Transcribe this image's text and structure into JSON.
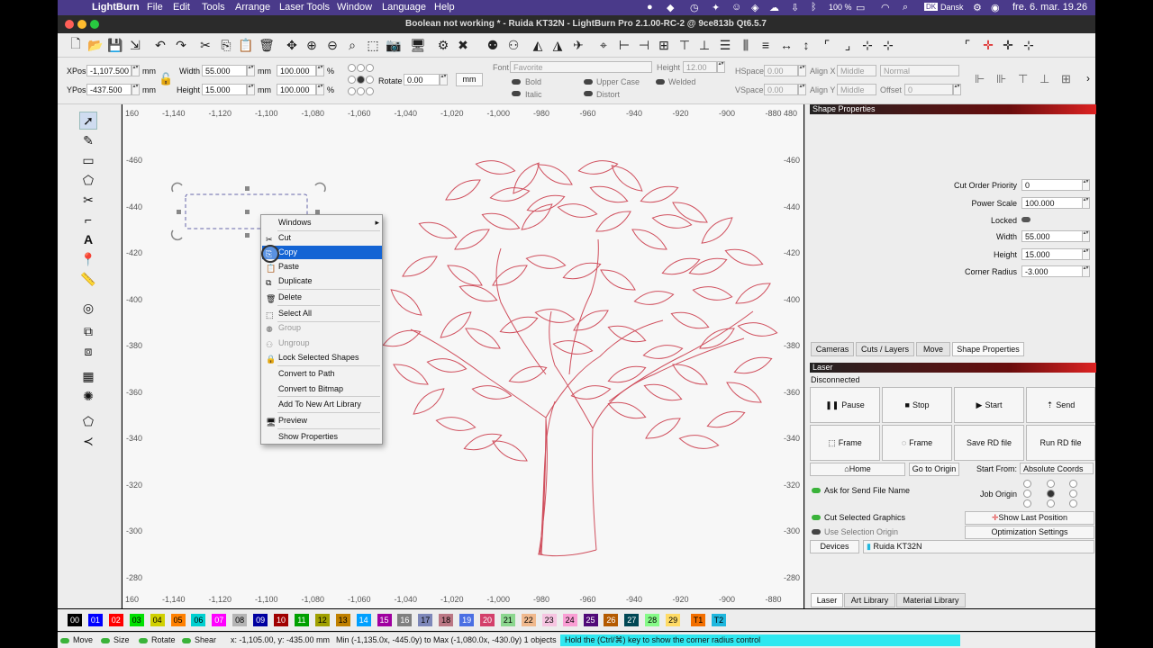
{
  "menubar": {
    "app": "LightBurn",
    "items": [
      "File",
      "Edit",
      "Tools",
      "Arrange",
      "Laser Tools",
      "Window",
      "Language",
      "Help"
    ],
    "battery": "100 %",
    "keyboard": "Dansk",
    "keyboard_badge": "DK",
    "datetime": "fre. 6. mar.  19.26"
  },
  "window_title": "Boolean not working * - Ruida KT32N - LightBurn Pro 2.1.00-RC-2 @ 9ce813b Qt6.5.7",
  "shape_props_bar": {
    "xpos_label": "XPos",
    "xpos": "-1,107.500",
    "ypos_label": "YPos",
    "ypos": "-437.500",
    "unit": "mm",
    "width_label": "Width",
    "width": "55.000",
    "height_label": "Height",
    "height": "15.000",
    "scale_w": "100.000",
    "scale_h": "100.000",
    "pct": "%",
    "rotate_label": "Rotate",
    "rotate": "0.00",
    "unit_button": "mm"
  },
  "text_bar": {
    "font_label": "Font",
    "font": "Favorite",
    "height_label": "Height",
    "height": "12.00",
    "hspace_label": "HSpace",
    "hspace": "0.00",
    "vspace_label": "VSpace",
    "vspace": "0.00",
    "alignx_label": "Align X",
    "alignx": "Middle",
    "aligny_label": "Align Y",
    "aligny": "Middle",
    "style": "Normal",
    "offset_label": "Offset",
    "offset": "0",
    "bold": "Bold",
    "italic": "Italic",
    "upper": "Upper Case",
    "distort": "Distort",
    "welded": "Welded"
  },
  "ruler": {
    "top": [
      "-1,140",
      "-1,120",
      "-1,100",
      "-1,080",
      "-1,060",
      "-1,040",
      "-1,020",
      "-1,000",
      "-980",
      "-960",
      "-940",
      "-920",
      "-900",
      "-880"
    ],
    "bottom": [
      "-1,140",
      "-1,120",
      "-1,100",
      "-1,080",
      "-1,060",
      "-1,040",
      "-1,020",
      "-1,000",
      "-980",
      "-960",
      "-940",
      "-920",
      "-900",
      "-880"
    ],
    "left": [
      "-460",
      "-440",
      "-420",
      "-400",
      "-380",
      "-360",
      "-340",
      "-320",
      "-300",
      "-280"
    ],
    "right": [
      "-460",
      "-440",
      "-420",
      "-400",
      "-380",
      "-360",
      "-340",
      "-320",
      "-300",
      "-280"
    ],
    "corner_top_left": "160",
    "corner_top_right": "480",
    "corner_bottom_left": "160"
  },
  "context_menu": [
    {
      "label": "Windows",
      "icon": "",
      "submenu": true
    },
    {
      "label": "Cut",
      "icon": "scissors-icon"
    },
    {
      "label": "Copy",
      "icon": "copy-icon",
      "selected": true
    },
    {
      "label": "Paste",
      "icon": "paste-icon"
    },
    {
      "label": "Duplicate",
      "icon": "duplicate-icon"
    },
    {
      "label": "Delete",
      "icon": "trash-icon"
    },
    {
      "label": "Select All",
      "icon": "select-all-icon"
    },
    {
      "label": "Group",
      "icon": "group-icon",
      "disabled": true
    },
    {
      "label": "Ungroup",
      "icon": "ungroup-icon",
      "disabled": true
    },
    {
      "label": "Lock Selected Shapes",
      "icon": "lock-icon"
    },
    {
      "label": "Convert to Path",
      "icon": ""
    },
    {
      "label": "Convert to Bitmap",
      "icon": ""
    },
    {
      "label": "Add To New Art Library",
      "icon": ""
    },
    {
      "label": "Preview",
      "icon": "monitor-icon"
    },
    {
      "label": "Show Properties",
      "icon": ""
    }
  ],
  "shape_properties": {
    "title": "Shape Properties",
    "cut_order_label": "Cut Order Priority",
    "cut_order": "0",
    "power_scale_label": "Power Scale",
    "power_scale": "100.000",
    "locked_label": "Locked",
    "width_label": "Width",
    "width": "55.000",
    "height_label": "Height",
    "height": "15.000",
    "corner_label": "Corner Radius",
    "corner": "-3.000"
  },
  "panel_tabs": [
    "Cameras",
    "Cuts / Layers",
    "Move",
    "Shape Properties"
  ],
  "laser": {
    "title": "Laser",
    "status": "Disconnected",
    "buttons": [
      "Pause",
      "Stop",
      "Start",
      "Send",
      "Frame",
      "Frame",
      "Save RD file",
      "Run RD file"
    ],
    "home": "Home",
    "go_origin": "Go to Origin",
    "start_from_label": "Start From:",
    "start_from": "Absolute Coords",
    "ask_name": "Ask for Send File Name",
    "job_origin": "Job Origin",
    "cut_selected": "Cut Selected Graphics",
    "use_sel_origin": "Use Selection Origin",
    "show_last": "Show Last Position",
    "opt_settings": "Optimization Settings",
    "devices": "Devices",
    "device": "Ruida KT32N"
  },
  "bottom_tabs": [
    "Laser",
    "Art Library",
    "Material Library"
  ],
  "palette": [
    {
      "label": "00",
      "color": "#000000",
      "text": "#ffffff"
    },
    {
      "label": "01",
      "color": "#0000ff",
      "text": "#ffffff"
    },
    {
      "label": "02",
      "color": "#ff0000",
      "text": "#ffffff"
    },
    {
      "label": "03",
      "color": "#00e000",
      "text": "#000000"
    },
    {
      "label": "04",
      "color": "#d0d000",
      "text": "#000000"
    },
    {
      "label": "05",
      "color": "#ff8000",
      "text": "#000000"
    },
    {
      "label": "06",
      "color": "#00d0d0",
      "text": "#000000"
    },
    {
      "label": "07",
      "color": "#ff00ff",
      "text": "#ffffff"
    },
    {
      "label": "08",
      "color": "#b4b4b4",
      "text": "#000000"
    },
    {
      "label": "09",
      "color": "#0000a0",
      "text": "#ffffff"
    },
    {
      "label": "10",
      "color": "#a00000",
      "text": "#ffffff"
    },
    {
      "label": "11",
      "color": "#00a000",
      "text": "#ffffff"
    },
    {
      "label": "12",
      "color": "#a0a000",
      "text": "#000000"
    },
    {
      "label": "13",
      "color": "#c08000",
      "text": "#000000"
    },
    {
      "label": "14",
      "color": "#00a0ff",
      "text": "#ffffff"
    },
    {
      "label": "15",
      "color": "#a000a0",
      "text": "#ffffff"
    },
    {
      "label": "16",
      "color": "#808080",
      "text": "#ffffff"
    },
    {
      "label": "17",
      "color": "#7d87b9",
      "text": "#000000"
    },
    {
      "label": "18",
      "color": "#bb7784",
      "text": "#000000"
    },
    {
      "label": "19",
      "color": "#4a6fe3",
      "text": "#ffffff"
    },
    {
      "label": "20",
      "color": "#d33f6a",
      "text": "#ffffff"
    },
    {
      "label": "21",
      "color": "#8cd78f",
      "text": "#000000"
    },
    {
      "label": "22",
      "color": "#f0b98d",
      "text": "#000000"
    },
    {
      "label": "23",
      "color": "#f6c4e1",
      "text": "#000000"
    },
    {
      "label": "24",
      "color": "#fa9ed4",
      "text": "#000000"
    },
    {
      "label": "25",
      "color": "#500a78",
      "text": "#ffffff"
    },
    {
      "label": "26",
      "color": "#b45a00",
      "text": "#ffffff"
    },
    {
      "label": "27",
      "color": "#004754",
      "text": "#ffffff"
    },
    {
      "label": "28",
      "color": "#86fa88",
      "text": "#000000"
    },
    {
      "label": "29",
      "color": "#ffdb66",
      "text": "#000000"
    },
    {
      "label": "T1",
      "color": "#f36f00",
      "text": "#000000"
    },
    {
      "label": "T2",
      "color": "#1fb7de",
      "text": "#000000"
    }
  ],
  "status": {
    "move": "Move",
    "size": "Size",
    "rotate": "Rotate",
    "shear": "Shear",
    "coords": "x: -1,105.00, y: -435.00 mm",
    "bounds": "Min (-1,135.0x, -445.0y) to Max (-1,080.0x, -430.0y)  1 objects",
    "hint": "Hold the (Ctrl/⌘) key to show the corner radius control"
  },
  "colors": {
    "accent": "#1364d4",
    "tree": "#d0505e",
    "hint_bg": "#2ee8f0"
  }
}
